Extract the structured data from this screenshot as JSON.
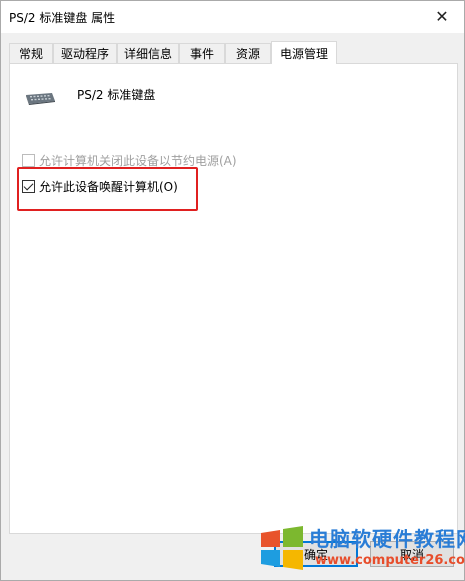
{
  "window": {
    "title": "PS/2 标准键盘 属性",
    "close_glyph": "✕"
  },
  "tabs": [
    {
      "label": "常规",
      "active": false
    },
    {
      "label": "驱动程序",
      "active": false
    },
    {
      "label": "详细信息",
      "active": false
    },
    {
      "label": "事件",
      "active": false
    },
    {
      "label": "资源",
      "active": false
    },
    {
      "label": "电源管理",
      "active": true
    }
  ],
  "device": {
    "icon": "keyboard-icon",
    "name": "PS/2 标准键盘"
  },
  "options": {
    "allow_off": {
      "label": "允许计算机关闭此设备以节约电源(A)",
      "checked": false,
      "enabled": false
    },
    "allow_wake": {
      "label": "允许此设备唤醒计算机(O)",
      "checked": true,
      "enabled": true
    }
  },
  "buttons": {
    "ok": "确定",
    "cancel": "取消"
  },
  "annotation": {
    "color": "#e02020"
  },
  "watermark": {
    "title": "电脑软硬件教程网",
    "url": "www.computer26.com",
    "title_color": "#2a7dd6",
    "url_color": "#e74d2b"
  }
}
